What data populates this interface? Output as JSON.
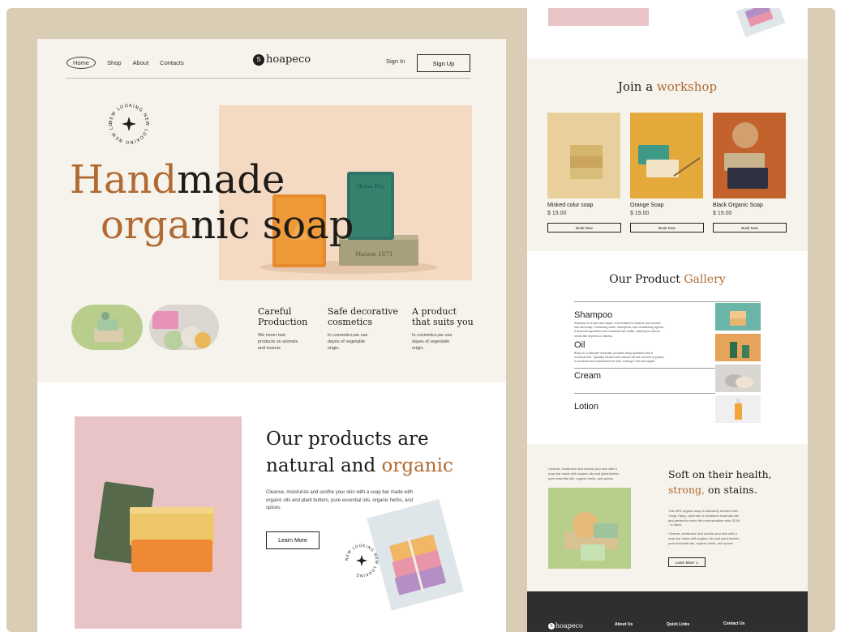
{
  "header": {
    "logo_initial": "S",
    "logo_text": "hoapeco",
    "nav": [
      "Home",
      "Shop",
      "About",
      "Contacts"
    ],
    "sign_in": "Sign In",
    "sign_up": "Sign Up"
  },
  "hero": {
    "badge_text": "NEW LOOKING NEW LOOKING NEW LOOKING",
    "title_line1_accent": "Hand",
    "title_line1_rest": "made",
    "title_line2_accent": "orga",
    "title_line2_rest": "nic soap",
    "soap_stamp_1": "Maison 1873",
    "soap_stamp_2": "Hyma Day"
  },
  "features": [
    {
      "title": "Careful Production",
      "desc": "We never test products on animals and insects"
    },
    {
      "title": "Safe decorative cosmetics",
      "desc": "In cosmetics,we use dayes of vegetable origin."
    },
    {
      "title": "A product that suits you",
      "desc": "In cosmetics,we use dayes of vegetable origin."
    }
  ],
  "products_section": {
    "title_line1": "Our products are",
    "title_line2_plain": "natural and ",
    "title_line2_accent": "organic",
    "desc": "Cleanse, moisturize and soothe your skin with a soap bar made with organic oils and plant butters, pure essential oils, organic herbs, and spices.",
    "button": "Learn More",
    "badge_text": "NEW LOOKING NEW LOOKING"
  },
  "workshop": {
    "title_plain": "Join a ",
    "title_accent": "workshop",
    "cards": [
      {
        "name": "Misked colur soap",
        "price": "$ 19.00",
        "button": "Book Now"
      },
      {
        "name": "Orange Soap",
        "price": "$ 19.00",
        "button": "Book Now"
      },
      {
        "name": "Black Organic Soap",
        "price": "$ 19.00",
        "button": "Book Now"
      }
    ]
  },
  "gallery": {
    "title_plain": "Our Product ",
    "title_accent": "Gallery",
    "items": [
      {
        "label": "Shampoo",
        "desc": "Shampoo is a hair care staple, a formulated to cleanse and nourish hair and scalp. Containing water, detergents, and conditioning agents, it removes impurities and enhances hair health, catering to various needs like dryness or oiliness."
      },
      {
        "label": "Oil",
        "desc": "Body oil, a skincare essential, provides deep hydration and a luxurious feel. Typically infused with natural oils like coconut or jojoba, it nourishes and moisturizes the skin, leaving it soft and supple."
      },
      {
        "label": "Cream",
        "desc": ""
      },
      {
        "label": "Lotion",
        "desc": ""
      }
    ]
  },
  "health": {
    "left_desc": "Cleanse, moisturize and soothe your skin with a soap bar made with organic oils and plant butters, pure essential oils, organic herbs, and spices.",
    "title_line1": "Soft on their health,",
    "title_line2_accent": "strong,",
    "title_line2_rest": " on stains.",
    "para1": "This 98% organic soap is delicately scented with Ylang Ylang, Lavender & Geranium essential oils and perfect for even the most sensitive skin. $750 - In stock.",
    "para2": "Cleanse, moisturize and soothe your skin with a soap bar made with organic oils and plant butters, pure essential oils, organic herbs, and spices.",
    "button": "Learn More"
  },
  "footer": {
    "logo_text": "hoapeco",
    "columns": [
      "About Us",
      "Quick Links",
      "Contact Us"
    ]
  },
  "colors": {
    "accent": "#b06a32",
    "frame": "#d9cdb6",
    "cream": "#f6f3ec",
    "peach": "#f4d9c3",
    "pink": "#e8c4c6",
    "footer": "#2f2f2f"
  }
}
